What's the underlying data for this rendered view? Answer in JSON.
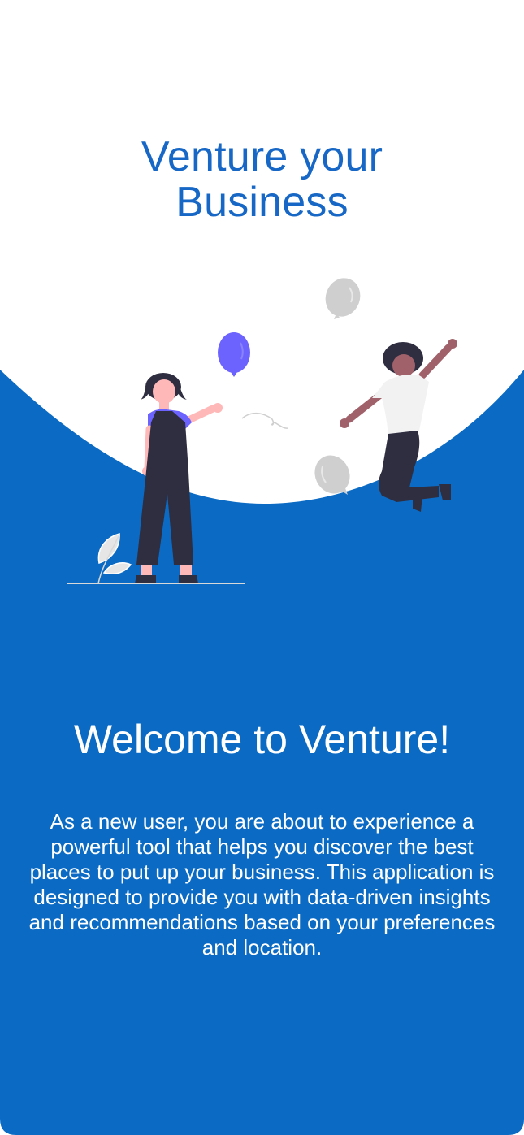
{
  "hero": {
    "title_line1": "Venture your",
    "title_line2": "Business"
  },
  "welcome": {
    "title": "Welcome to Venture!",
    "body": "As a new user, you are about to experience a powerful tool that helps you discover the best places to put up your business. This application is designed to provide you with data-driven insights and recommendations based on your preferences and location."
  },
  "theme": {
    "primary_blue": "#0b6bc4",
    "title_blue": "#1768c6",
    "background": "#ffffff",
    "balloon_purple": "#6c63ff",
    "balloon_gray": "#cfcfcf"
  },
  "illustration": {
    "name": "celebrating-people-with-balloons"
  }
}
